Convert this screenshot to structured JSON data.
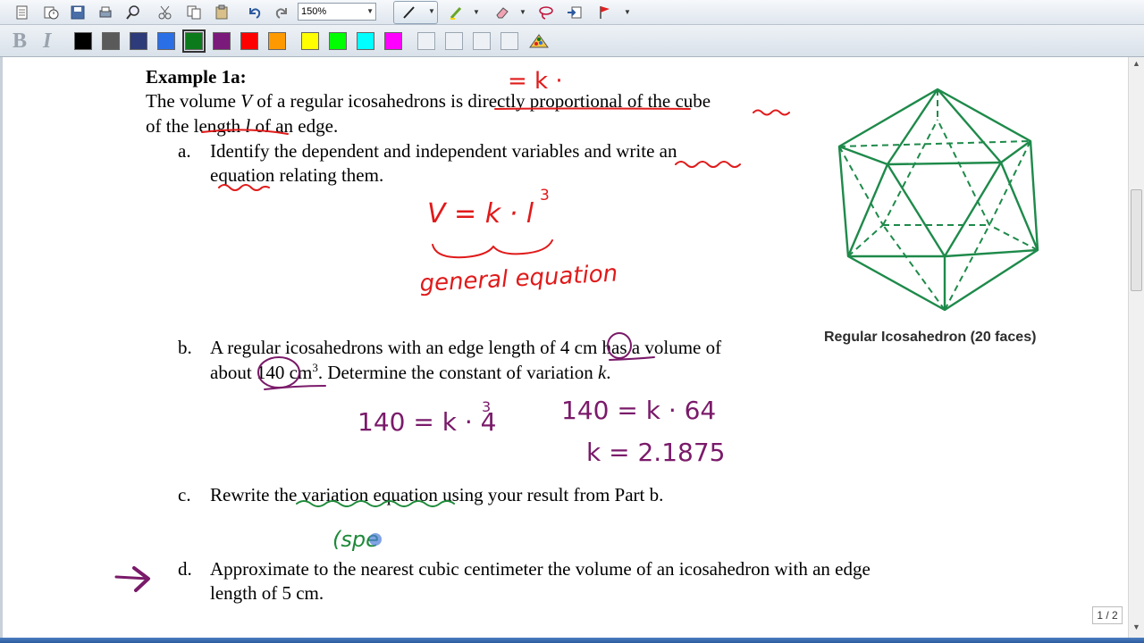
{
  "toolbar": {
    "zoom_value": "150%",
    "icons": [
      "new-page-icon",
      "clock-icon",
      "save-icon",
      "print-icon",
      "zoom-icon",
      "cut-icon",
      "copy-icon",
      "paste-icon",
      "undo-icon",
      "redo-icon",
      "pen-icon",
      "highlighter-icon",
      "eraser-icon",
      "lasso-icon",
      "insert-icon",
      "flag-icon"
    ],
    "bold_label": "B",
    "italic_label": "I",
    "colors": [
      "#000000",
      "#5a5a5a",
      "#2e3b7a",
      "#2a6fe6",
      "#0a7a1a",
      "#7a1a7a",
      "#ff0000",
      "#ff9900",
      "#ffff00",
      "#00ff00",
      "#00ffff",
      "#ff00ff"
    ]
  },
  "document": {
    "example_title": "Example 1a:",
    "intro_line1_a": "The volume ",
    "intro_var_v": "V",
    "intro_line1_b": " of a regular icosahedrons is directly proportional of the cube",
    "intro_line2_a": "of the length ",
    "intro_var_l": "l",
    "intro_line2_b": " of an edge.",
    "part_a_label": "a.",
    "part_a_line1": "Identify the dependent and independent variables and write an",
    "part_a_line2": "equation relating them.",
    "part_b_label": "b.",
    "part_b_line1": "A regular icosahedrons with an edge length of 4 cm has a volume of",
    "part_b_line2_a": "about 140 cm",
    "part_b_line2_sup": "3",
    "part_b_line2_b": ".  Determine the constant of variation ",
    "part_b_var_k": "k",
    "part_b_line2_c": ".",
    "part_c_label": "c.",
    "part_c_line1": "Rewrite the variation equation using your result from Part b.",
    "part_d_label": "d.",
    "part_d_line1": "Approximate to the nearest cubic centimeter the volume of an icosahedron with an edge",
    "part_d_line2": "length of 5 cm.",
    "figure_caption": "Regular Icosahedron (20 faces)"
  },
  "annotations": {
    "top_note": "= k ·",
    "equation": "V = k · l",
    "equation_exp": "3",
    "general_label": "general equation",
    "b_eq1": "140 = k · 4",
    "b_eq1_exp": "3",
    "b_eq2": "140 = k · 64",
    "b_eq3": "k = 2.1875",
    "c_note": "(spe"
  },
  "page_indicator": "1 / 2"
}
